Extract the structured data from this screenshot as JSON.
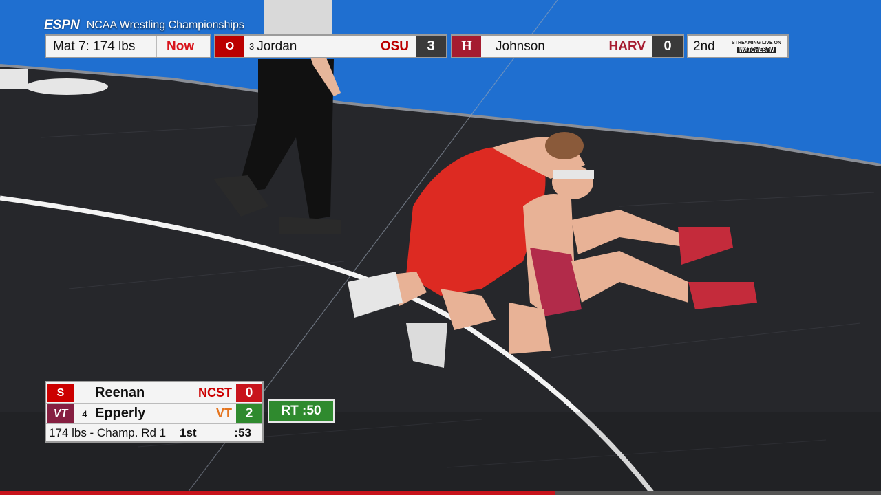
{
  "broadcast": {
    "network": "ESPN",
    "event": "NCAA Wrestling Championships",
    "mat_label": "Mat 7: 174 lbs",
    "status": "Now",
    "period": "2nd",
    "streaming_text": "STREAMING LIVE ON",
    "watch_label": "WATCHESPN"
  },
  "featured_match": {
    "wrestler1": {
      "seed": "3",
      "name": "Jordan",
      "team": "OSU",
      "score": "3",
      "logo": "O",
      "team_color": "#bb0000"
    },
    "wrestler2": {
      "seed": "",
      "name": "Johnson",
      "team": "HARV",
      "score": "0",
      "logo": "H",
      "team_color": "#a51c30"
    }
  },
  "current_match": {
    "wrestler1": {
      "seed": "",
      "name": "Reenan",
      "team": "NCST",
      "score": "0",
      "logo": "S",
      "team_color": "#cc0000"
    },
    "wrestler2": {
      "seed": "4",
      "name": "Epperly",
      "team": "VT",
      "score": "2",
      "logo": "VT",
      "team_color": "#e5751f"
    },
    "weight_round": "174 lbs - Champ. Rd 1",
    "period": "1st",
    "clock": ":53",
    "riding_time": "RT :50"
  },
  "progress": {
    "fraction": 0.63,
    "color": "#c8141c"
  }
}
